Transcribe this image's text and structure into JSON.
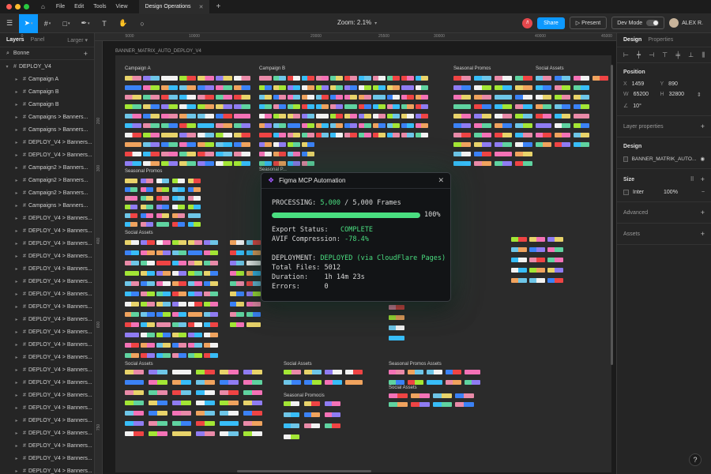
{
  "app": {
    "menu": [
      "File",
      "Edit",
      "Tools",
      "View"
    ],
    "tab_title": "Design Operations",
    "tab_close": "✕",
    "new_tab": "+"
  },
  "toolbar": {
    "zoom_label": "Zoom: 2.1%",
    "collab_initials": "Л",
    "share_label": "Share",
    "present_label": "Present",
    "devmode_label": "Dev Mode",
    "user_name": "ALEX R."
  },
  "left_panel": {
    "tabs": [
      "Layers",
      "Panel"
    ],
    "size_toggle": "Larger",
    "page_name": "Bonne",
    "root_layer": "DEPLOY_V4",
    "layers": [
      "Campaign A",
      "Campaign B",
      "Campaign B",
      "Campaigns > Banners...",
      "Campaigns > Banners...",
      "DEPLOY_V4 > Banners...",
      "DEPLOY_V4 > Banners...",
      "Campaign2 > Banners...",
      "Campaign2 > Banners...",
      "Campaign2 > Banners...",
      "Campaigns > Banners...",
      "DEPLOY_V4 > Banners...",
      "DEPLOY_V4 > Banners...",
      "DEPLOY_V4 > Banners...",
      "DEPLOY_V4 > Banners...",
      "DEPLOY_V4 > Banners...",
      "DEPLOY_V4 > Banners...",
      "DEPLOY_V4 > Banners...",
      "DEPLOY_V4 > Banners...",
      "DEPLOY_V4 > Banners...",
      "DEPLOY_V4 > Banners...",
      "DEPLOY_V4 > Banners...",
      "DEPLOY_V4 > Banners...",
      "DEPLOY_V4 > Banners...",
      "DEPLOY_V4 > Banners...",
      "DEPLOY_V4 > Banners...",
      "DEPLOY_V4 > Banners...",
      "DEPLOY_V4 > Banners...",
      "DEPLOY_V4 > Banners...",
      "DEPLOY_V4 > Banners...",
      "DEPLOY_V4 > Banners...",
      "DEPLOY_V4 > Banners..."
    ]
  },
  "ruler": {
    "top": [
      "0",
      "5000",
      "10000",
      "20000",
      "25500",
      "30000",
      "40000",
      "45000"
    ],
    "left": [
      "200",
      "300",
      "400",
      "600",
      "750"
    ]
  },
  "canvas": {
    "artboard_name": "BANNER_MATRIX_AUTO_DEPLOY_V4",
    "sections": {
      "campaign_a": "Campaign A",
      "campaign_b": "Campaign B",
      "seasonal_top": "Seasonal Promos",
      "social_top": "Social Assets",
      "seasonal_mid": "Seasonal Promos",
      "social_mid": "Social Assets",
      "seasonal_hidden": "Seasonal P...",
      "social_bottom": "Social Assets",
      "social_bottom2": "Social Assets",
      "seasonal_bottom": "Seasonal Promocis",
      "seasonal_bottom_right": "Seasonal Promos Assets",
      "social_bottom_right": "Social Assets"
    }
  },
  "modal": {
    "title": "Figma MCP Automation",
    "close": "✕",
    "processing_label": "PROCESSING: ",
    "processing_value": "5,000",
    "processing_rest": " / 5,000 Frames",
    "progress_percent": 100,
    "progress_label": "100%",
    "export_label": "Export Status:   ",
    "export_value": "COMPLETE",
    "avif_label": "AVIF Compression: ",
    "avif_value": "-78.4%",
    "deploy_label": "DEPLOYMENT: ",
    "deploy_value": "DEPLOYED (via CloudFlare Pages)",
    "files_label": "Total Files: ",
    "files_value": "5012",
    "duration_label": "Duration:    ",
    "duration_value": "1h 14m 23s",
    "errors_label": "Errors:      ",
    "errors_value": "0"
  },
  "right_panel": {
    "tabs": [
      "Design",
      "Properties"
    ],
    "position_title": "Position",
    "x_label": "X",
    "x_value": "1459",
    "y_label": "Y",
    "y_value": "890",
    "w_label": "W",
    "w_value": "65200",
    "h_label": "H",
    "h_value": "32800",
    "rotation": "10°",
    "layer_props": "Layer properties",
    "design_title": "Design",
    "design_fill": "BANNER_MATRIK_AUTO...",
    "size_title": "Size",
    "font_name": "Inter",
    "font_percent": "100%",
    "advanced": "Advanced",
    "assets": "Assets"
  },
  "colors": {
    "accent": "#0d99ff",
    "success": "#4ade80"
  }
}
